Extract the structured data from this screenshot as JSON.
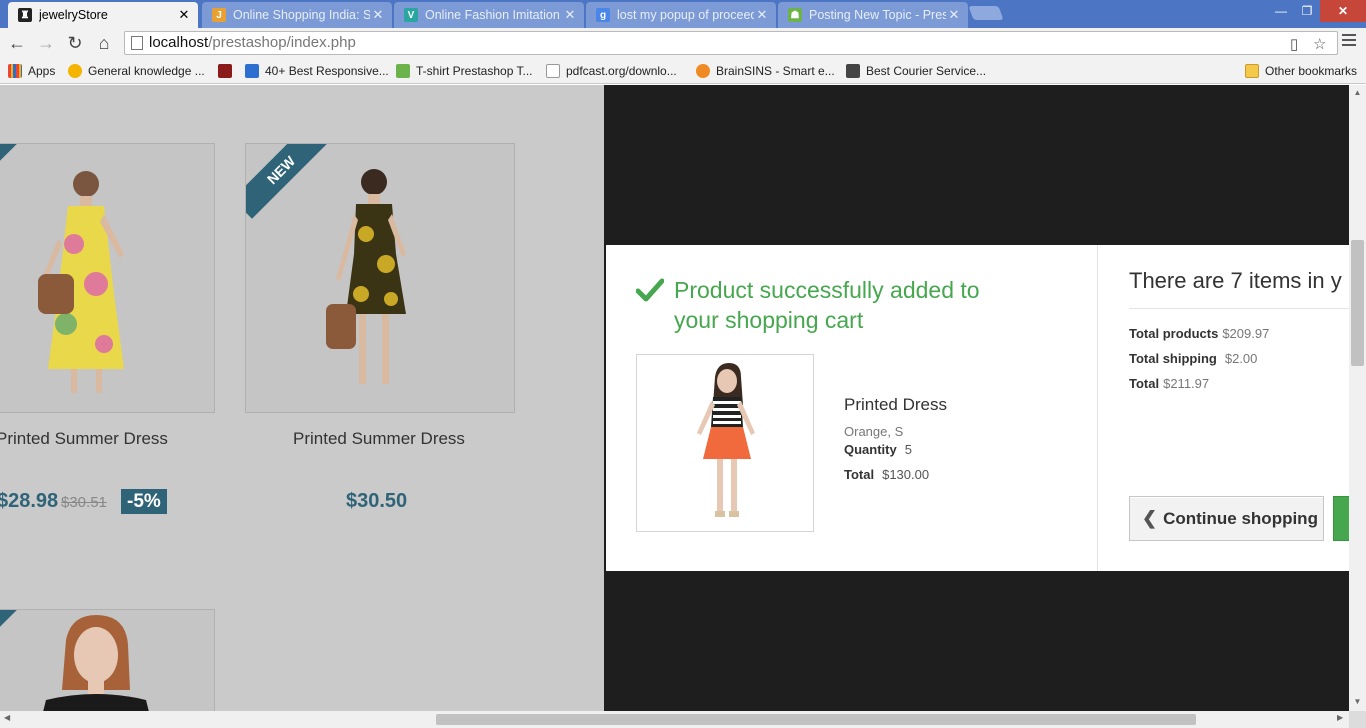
{
  "browser": {
    "tabs": [
      {
        "title": "jewelryStore",
        "favicon_color": "#222222",
        "favicon_glyph": "♜",
        "active": true
      },
      {
        "title": "Online Shopping India: Sh",
        "favicon_color": "#e8a033",
        "favicon_glyph": "J",
        "active": false
      },
      {
        "title": "Online Fashion Imitation J",
        "favicon_color": "#2aa6a0",
        "favicon_glyph": "V",
        "active": false
      },
      {
        "title": "lost my popup of proceed",
        "favicon_color": "#4a86e8",
        "favicon_glyph": "g",
        "active": false
      },
      {
        "title": "Posting New Topic - Prest",
        "favicon_color": "#6bb34a",
        "favicon_glyph": "☗",
        "active": false
      }
    ],
    "tab_close_glyph": "✕",
    "window_controls": {
      "minimize": "—",
      "restore": "❐",
      "close": "✕"
    },
    "nav": {
      "back": "←",
      "forward": "→",
      "reload": "↻",
      "home": "⌂"
    },
    "url": {
      "host": "localhost",
      "path": "/prestashop/index.php"
    },
    "omnibox_icons": {
      "reader": "▯",
      "star": "☆"
    },
    "bookmarks": [
      {
        "label": "Apps",
        "icon_color": "#e8453c"
      },
      {
        "label": "General knowledge ...",
        "icon_color": "#f4b400"
      },
      {
        "label": "",
        "icon_color": "#8b1a1a"
      },
      {
        "label": "40+ Best Responsive...",
        "icon_color": "#2c6fd1"
      },
      {
        "label": "T-shirt Prestashop T...",
        "icon_color": "#6bb34a"
      },
      {
        "label": "pdfcast.org/downlo...",
        "icon_color": "#ffffff"
      },
      {
        "label": "BrainSINS - Smart e...",
        "icon_color": "#f08a24"
      },
      {
        "label": "Best Courier Service...",
        "icon_color": "#444444"
      }
    ],
    "other_bookmarks": "Other bookmarks"
  },
  "store": {
    "products": [
      {
        "name": "Printed Summer Dress",
        "price": "$28.98",
        "old_price": "$30.51",
        "discount": "-5%",
        "ribbon": ""
      },
      {
        "name": "Printed Summer Dress",
        "price": "$30.50",
        "old_price": "",
        "discount": "",
        "ribbon": "NEW"
      }
    ]
  },
  "modal": {
    "success_message": "Product successfully added to your shopping cart",
    "item": {
      "name": "Printed Dress",
      "attributes": "Orange, S",
      "quantity_label": "Quantity",
      "quantity": "5",
      "total_label": "Total",
      "total": "$130.00"
    },
    "cart": {
      "title": "There are 7 items in y",
      "total_products_label": "Total products",
      "total_products": "$209.97",
      "total_shipping_label": "Total shipping",
      "total_shipping": "$2.00",
      "total_label": "Total",
      "total": "$211.97",
      "continue_label": "Continue shopping"
    },
    "colors": {
      "success": "#46a74e",
      "accent": "#2f6378"
    }
  }
}
